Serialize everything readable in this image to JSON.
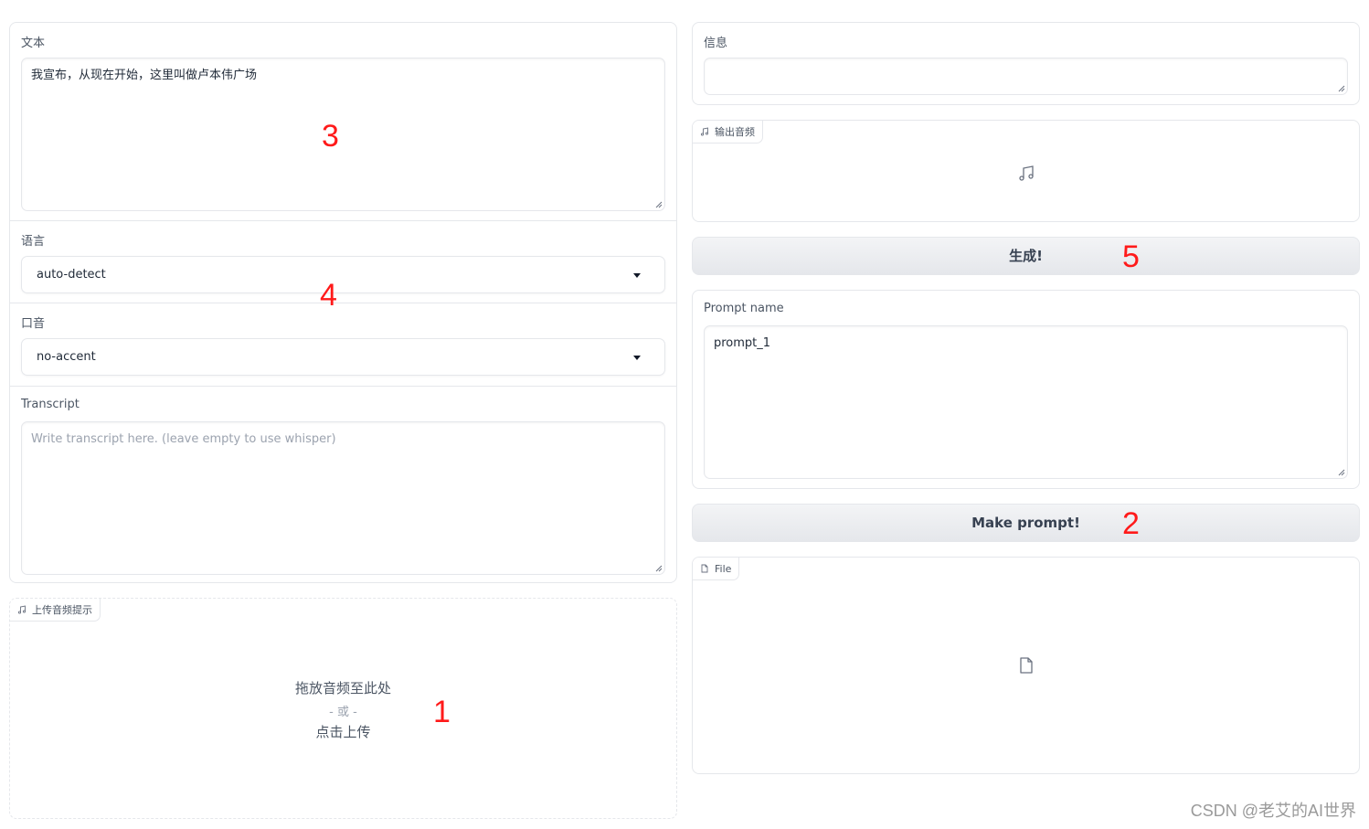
{
  "left": {
    "text_label": "文本",
    "text_value": "我宣布，从现在开始，这里叫做卢本伟广场",
    "language_label": "语言",
    "language_value": "auto-detect",
    "accent_label": "口音",
    "accent_value": "no-accent",
    "transcript_label": "Transcript",
    "transcript_placeholder": "Write transcript here. (leave empty to use whisper)",
    "upload_tag": "上传音频提示",
    "upload_drop": "拖放音频至此处",
    "upload_or": "- 或 -",
    "upload_click": "点击上传"
  },
  "right": {
    "info_label": "信息",
    "output_audio_tag": "输出音频",
    "generate_button": "生成!",
    "prompt_name_label": "Prompt name",
    "prompt_name_value": "prompt_1",
    "make_prompt_button": "Make prompt!",
    "file_tag": "File"
  },
  "annotations": {
    "a1": "1",
    "a2": "2",
    "a3": "3",
    "a4": "4",
    "a5": "5"
  },
  "watermark": "CSDN @老艾的AI世界",
  "icons": [
    "music-icon",
    "file-icon",
    "resize-handle-icon",
    "chevron-down-icon"
  ]
}
